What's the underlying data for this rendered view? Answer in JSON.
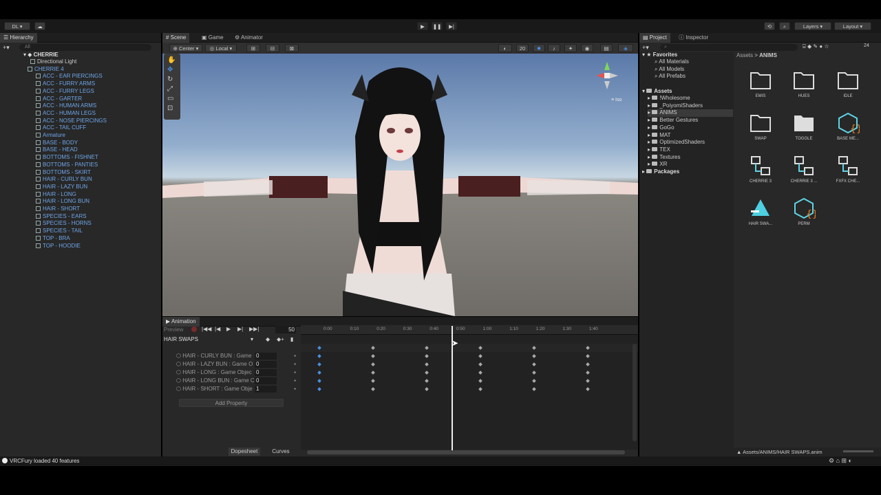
{
  "toolbar": {
    "account": "DL",
    "layers": "Layers",
    "layout": "Layout"
  },
  "hierarchy": {
    "tab": "Hierarchy",
    "search_placeholder": "All",
    "root": "CHERRIE",
    "items": [
      {
        "label": "Directional Light",
        "color": "#cccccc"
      },
      {
        "label": "CHERRIE 4",
        "color": "#6fa6e8"
      },
      {
        "label": "ACC - EAR PIERCINGS"
      },
      {
        "label": "ACC - FURRY ARMS"
      },
      {
        "label": "ACC - FURRY LEGS"
      },
      {
        "label": "ACC - GARTER"
      },
      {
        "label": "ACC - HUMAN ARMS"
      },
      {
        "label": "ACC - HUMAN LEGS"
      },
      {
        "label": "ACC - NOSE PIERCINGS"
      },
      {
        "label": "ACC - TAIL CUFF"
      },
      {
        "label": "Armature"
      },
      {
        "label": "BASE - BODY"
      },
      {
        "label": "BASE - HEAD"
      },
      {
        "label": "BOTTOMS - FISHNET"
      },
      {
        "label": "BOTTOMS - PANTIES"
      },
      {
        "label": "BOTTOMS - SKIRT"
      },
      {
        "label": "HAIR - CURLY BUN"
      },
      {
        "label": "HAIR - LAZY BUN"
      },
      {
        "label": "HAIR - LONG"
      },
      {
        "label": "HAIR - LONG BUN"
      },
      {
        "label": "HAIR - SHORT"
      },
      {
        "label": "SPECIES - EARS"
      },
      {
        "label": "SPECIES - HORNS"
      },
      {
        "label": "SPECIES - TAIL"
      },
      {
        "label": "TOP - BRA"
      },
      {
        "label": "TOP - HOODIE"
      }
    ]
  },
  "scene": {
    "tabs": [
      "Scene",
      "Game",
      "Animator"
    ],
    "pivot": "Center",
    "space": "Local",
    "num": "20",
    "iso": "Iso"
  },
  "animation": {
    "tab": "Animation",
    "preview": "Preview",
    "frame": "50",
    "clip": "HAIR SWAPS",
    "ticks": [
      "0:00",
      "0:10",
      "0:20",
      "0:30",
      "0:40",
      "0:50",
      "1:00",
      "1:10",
      "1:20",
      "1:30",
      "1:40"
    ],
    "properties": [
      {
        "name": "HAIR - CURLY BUN : Game",
        "value": "0"
      },
      {
        "name": "HAIR - LAZY BUN : Game O",
        "value": "0"
      },
      {
        "name": "HAIR - LONG : Game Objec",
        "value": "0"
      },
      {
        "name": "HAIR - LONG BUN : Game C",
        "value": "0"
      },
      {
        "name": "HAIR - SHORT : Game Obje",
        "value": "1"
      }
    ],
    "add_property": "Add Property",
    "dopesheet": "Dopesheet",
    "curves": "Curves"
  },
  "project": {
    "tabs": [
      "Project",
      "Inspector"
    ],
    "favorites": "Favorites",
    "favorite_items": [
      "All Materials",
      "All Models",
      "All Prefabs"
    ],
    "assets": "Assets",
    "asset_folders": [
      "!Wholesome",
      "_PoiyomiShaders",
      "ANIMS",
      "Better Gestures",
      "GoGo",
      "MAT",
      "OptimizedShaders",
      "TEX",
      "Textures",
      "XR"
    ],
    "packages": "Packages",
    "breadcrumb": [
      "Assets",
      "ANIMS"
    ],
    "grid": [
      {
        "label": "EMIS",
        "icon": "folder"
      },
      {
        "label": "HUES",
        "icon": "folder"
      },
      {
        "label": "IDLE",
        "icon": "folder"
      },
      {
        "label": "SWAP",
        "icon": "folder"
      },
      {
        "label": "TOGGLE",
        "icon": "folder-filled"
      },
      {
        "label": "BASE ME...",
        "icon": "prefab-script"
      },
      {
        "label": "CHERRIE 3",
        "icon": "animator"
      },
      {
        "label": "CHERRIE 3 ...",
        "icon": "animator"
      },
      {
        "label": "FXFX CHE...",
        "icon": "animator"
      },
      {
        "label": "HAIR SWA...",
        "icon": "anim-clip"
      },
      {
        "label": "PERM",
        "icon": "prefab-script"
      }
    ],
    "path": "Assets/ANIMS/HAIR SWAPS.anim",
    "count": "24"
  },
  "status": {
    "message": "VRCFury loaded 40 features"
  },
  "colors": {
    "accent": "#4a90e2",
    "panel": "#282828",
    "asset_teal": "#4dd0e1"
  }
}
